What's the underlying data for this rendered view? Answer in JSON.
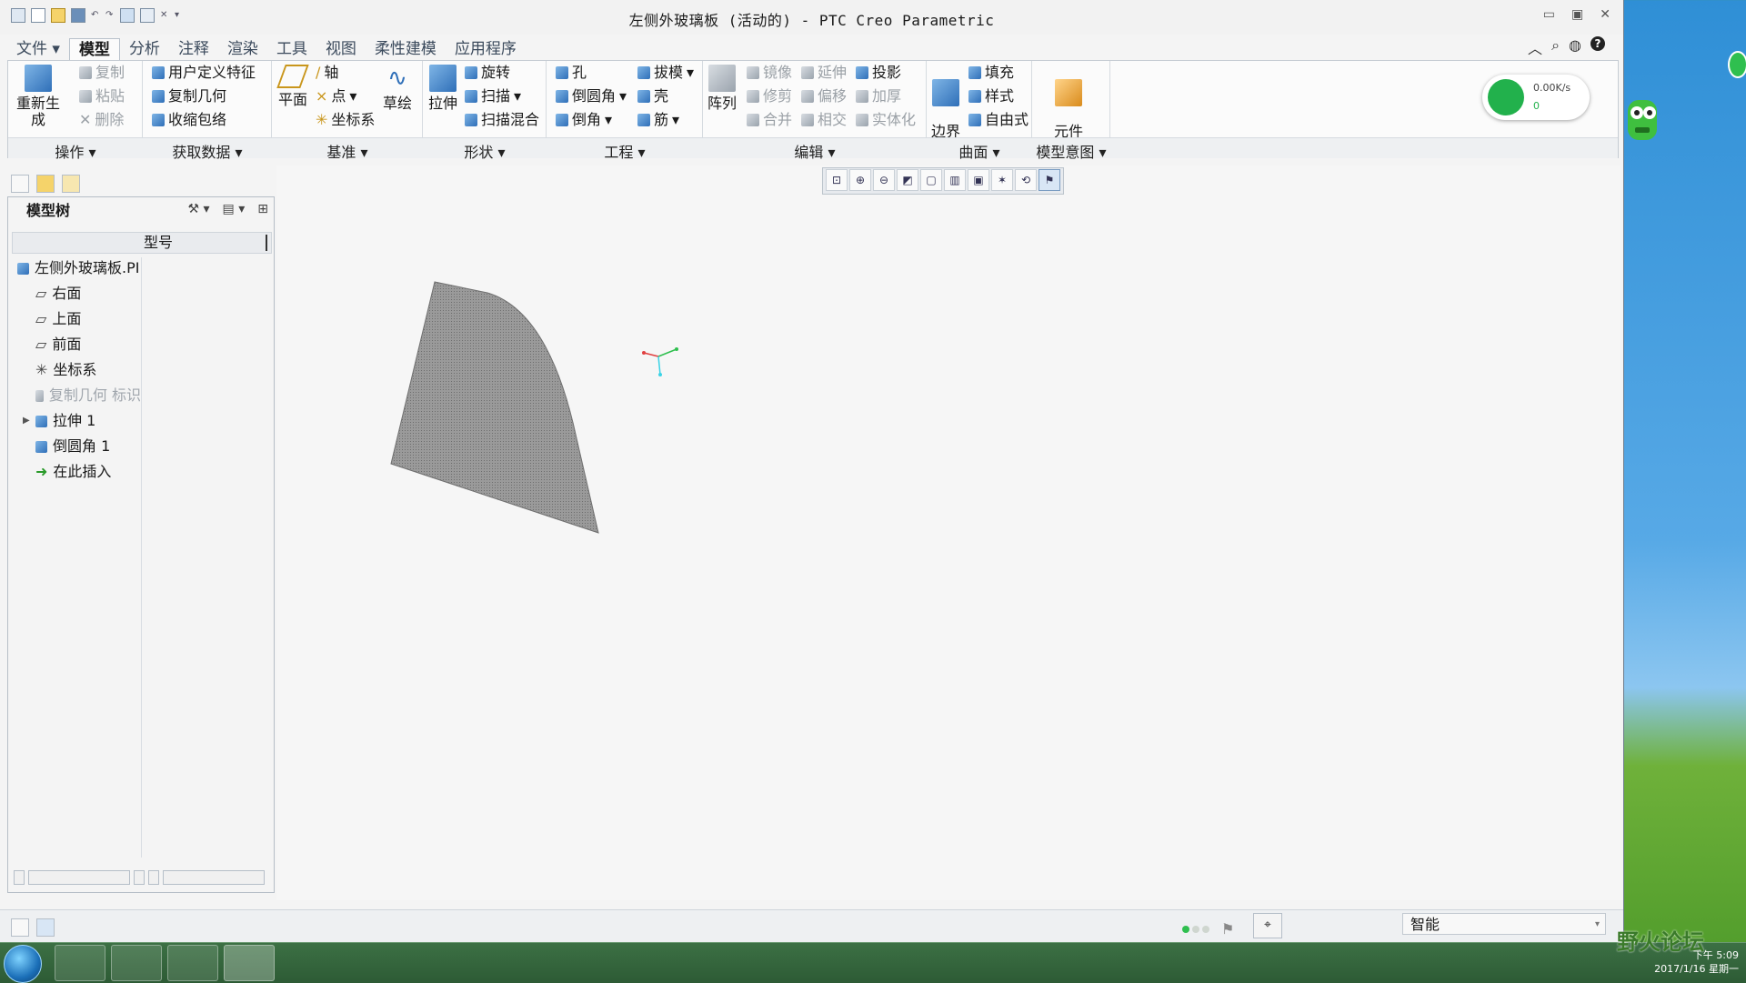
{
  "window": {
    "title": "左侧外玻璃板 (活动的) - PTC Creo Parametric"
  },
  "tabs": [
    {
      "label": "文件",
      "has_menu": true
    },
    {
      "label": "模型",
      "active": true
    },
    {
      "label": "分析"
    },
    {
      "label": "注释"
    },
    {
      "label": "渲染"
    },
    {
      "label": "工具"
    },
    {
      "label": "视图"
    },
    {
      "label": "柔性建模"
    },
    {
      "label": "应用程序"
    }
  ],
  "ribbon": {
    "groups": [
      "操作",
      "获取数据",
      "基准",
      "形状",
      "工程",
      "编辑",
      "曲面",
      "模型意图"
    ],
    "operations": {
      "regenerate": "重新生成",
      "copy": "复制",
      "paste": "粘贴",
      "delete": "删除"
    },
    "get_data": {
      "udf": "用户定义特征",
      "copy_geom": "复制几何",
      "shrinkwrap": "收缩包络"
    },
    "datum": {
      "plane": "平面",
      "axis": "轴",
      "point": "点",
      "csys": "坐标系",
      "sketch": "草绘"
    },
    "shapes": {
      "extrude": "拉伸",
      "revolve": "旋转",
      "sweep": "扫描",
      "swept_blend": "扫描混合"
    },
    "engineering": {
      "hole": "孔",
      "round": "倒圆角",
      "chamfer": "倒角",
      "draft": "拔模",
      "shell": "壳",
      "rib": "筋"
    },
    "editing": {
      "pattern": "阵列",
      "mirror": "镜像",
      "trim": "修剪",
      "merge": "合并",
      "extend": "延伸",
      "offset": "偏移",
      "intersect": "相交",
      "project": "投影",
      "thicken": "加厚",
      "solidify": "实体化"
    },
    "surfaces": {
      "boundary_blend": "边界\n混合",
      "fill": "填充",
      "style": "样式",
      "freestyle": "自由式"
    },
    "model_intent": {
      "component_interface": "元件\n界面"
    }
  },
  "network_widget": {
    "speed": "0.00K/s",
    "count": "0"
  },
  "model_tree": {
    "title": "模型树",
    "column": "型号",
    "items": [
      {
        "label": "左侧外玻璃板.PI",
        "icon": "part-icon",
        "level": 0
      },
      {
        "label": "右面",
        "icon": "datum-plane-icon",
        "level": 1
      },
      {
        "label": "上面",
        "icon": "datum-plane-icon",
        "level": 1
      },
      {
        "label": "前面",
        "icon": "datum-plane-icon",
        "level": 1
      },
      {
        "label": "坐标系",
        "icon": "csys-icon",
        "level": 1
      },
      {
        "label": "复制几何 标识",
        "icon": "copy-geom-icon",
        "level": 1,
        "disabled": true
      },
      {
        "label": "拉伸 1",
        "icon": "extrude-icon",
        "level": 1,
        "expandable": true
      },
      {
        "label": "倒圆角 1",
        "icon": "round-icon",
        "level": 1
      },
      {
        "label": "在此插入",
        "icon": "insert-here-icon",
        "level": 1
      }
    ]
  },
  "view_toolbar": [
    "refit-icon",
    "zoom-in-icon",
    "zoom-out-icon",
    "repaint-icon",
    "saved-views-icon",
    "view-manager-icon",
    "display-style-icon",
    "datum-display-icon",
    "spin-center-icon",
    "annotation-display-icon"
  ],
  "status": {
    "filter": "智能"
  },
  "watermark": "野火论坛",
  "tray": {
    "time": "下午 5:09",
    "date": "2017/1/16 星期一"
  },
  "colors": {
    "accent": "#2f6fb8",
    "geometry": "#8c8c8c",
    "tab_text": "#3b4a5c"
  }
}
